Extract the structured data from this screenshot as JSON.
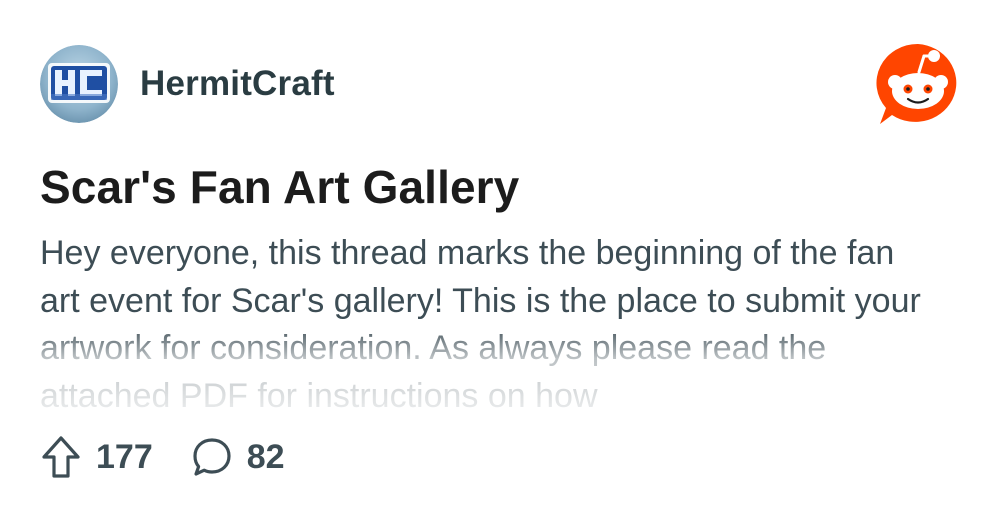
{
  "subreddit": {
    "name": "HermitCraft",
    "avatar_icon": "hermitcraft-logo-icon",
    "avatar_text": "HC"
  },
  "app": {
    "logo_icon": "reddit-logo-icon",
    "brand_color": "#FF4500"
  },
  "post": {
    "title": "Scar's Fan Art Gallery",
    "body": "Hey everyone, this thread marks the beginning of the fan art event for Scar's gallery! This is the place to submit your artwork for consideration. As always please read the attached PDF for instructions on how"
  },
  "actions": {
    "upvote_icon": "upvote-arrow-icon",
    "upvotes": "177",
    "comment_icon": "comment-bubble-icon",
    "comments": "82"
  },
  "colors": {
    "text_primary": "#1c1c1c",
    "text_secondary": "#3d4d55"
  }
}
